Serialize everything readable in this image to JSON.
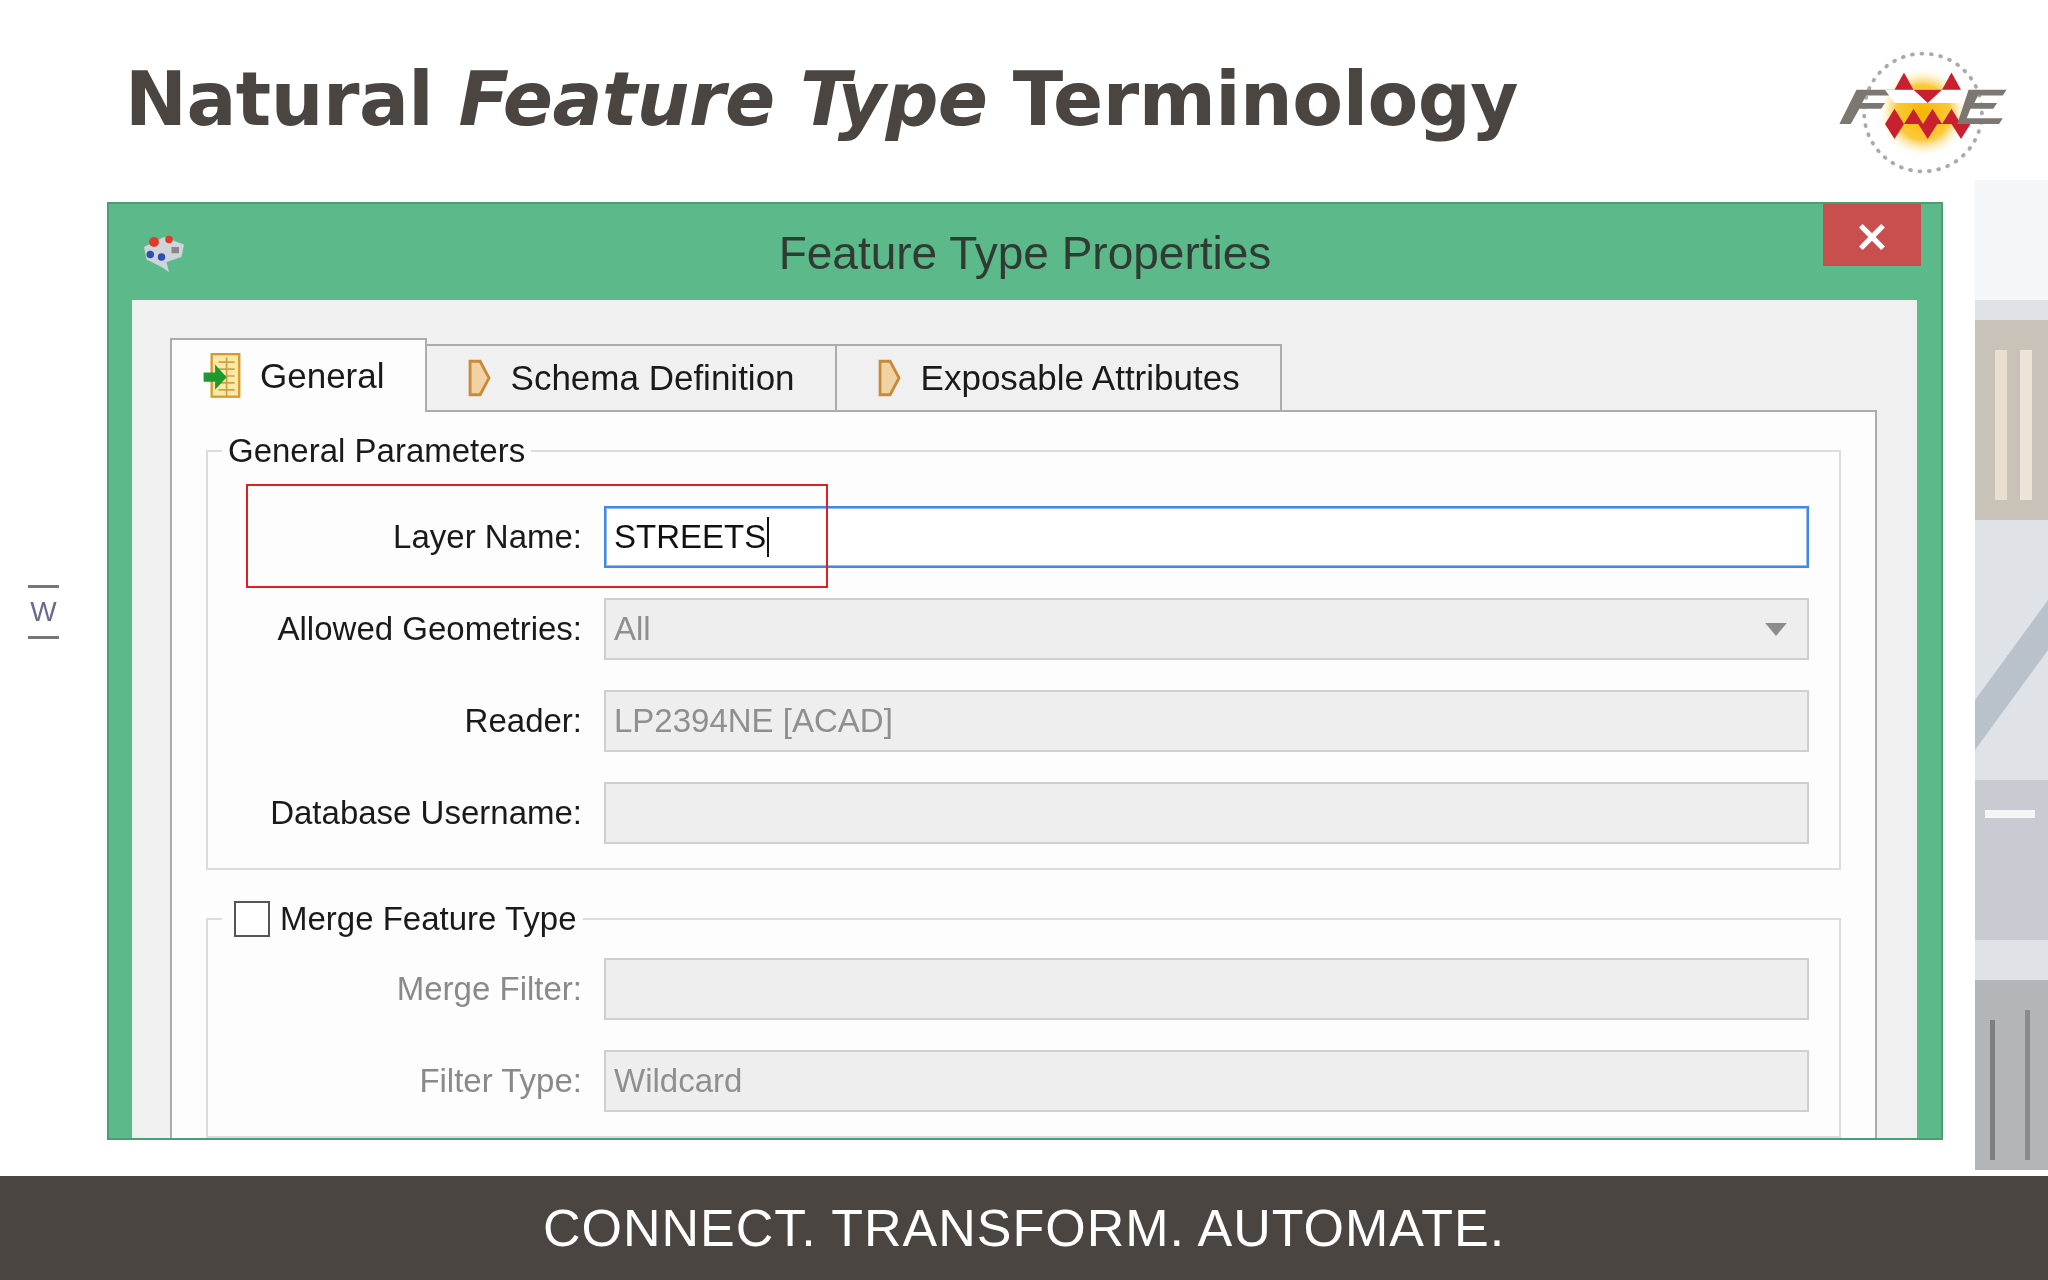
{
  "slide": {
    "title": "Natural *Feature Type* Terminology",
    "side_letter": "W",
    "footer": "CONNECT. TRANSFORM. AUTOMATE."
  },
  "dialog": {
    "title": "Feature Type Properties",
    "close": "×",
    "tabs": [
      {
        "label": "General",
        "selected": true
      },
      {
        "label": "Schema Definition",
        "selected": false
      },
      {
        "label": "Exposable Attributes",
        "selected": false
      }
    ],
    "general_parameters": {
      "title": "General Parameters",
      "fields": [
        {
          "label": "Layer Name:",
          "value": "STREETS",
          "kind": "text",
          "focused": true,
          "disabled": false,
          "highlighted": true
        },
        {
          "label": "Allowed Geometries:",
          "value": "All",
          "kind": "combo",
          "focused": false,
          "disabled": true,
          "highlighted": false
        },
        {
          "label": "Reader:",
          "value": "LP2394NE [ACAD]",
          "kind": "text",
          "focused": false,
          "disabled": true,
          "highlighted": false
        },
        {
          "label": "Database Username:",
          "kind": "text",
          "focused": false,
          "disabled": true,
          "highlighted": false
        }
      ]
    },
    "merge": {
      "label": "Merge Feature Type",
      "checked": false,
      "fields": [
        {
          "label": "Merge Filter:",
          "kind": "text",
          "disabled": true
        },
        {
          "label": "Filter Type:",
          "value": "Wildcard",
          "kind": "text",
          "disabled": true
        }
      ]
    }
  }
}
